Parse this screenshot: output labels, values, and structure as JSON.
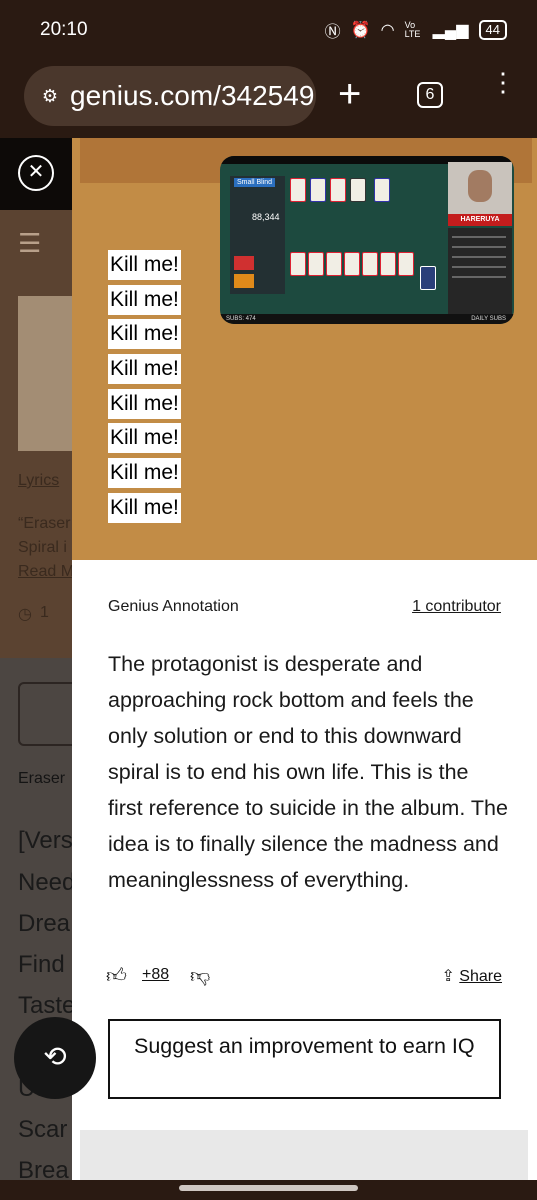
{
  "status_bar": {
    "time": "20:10",
    "battery": "44",
    "network": "Vo LTE"
  },
  "browser": {
    "url": "genius.com/342549",
    "tab_count": "6"
  },
  "background_page": {
    "lyrics_link": "Lyrics",
    "description_line1": "“Eraser",
    "description_line2": "Spiral i",
    "read_more": "Read M",
    "history_count": "1",
    "album_label": "Eraser",
    "lyric_fragments": [
      "[Vers",
      "Need",
      "Drea",
      "Find",
      "Taste",
      "Use",
      "Scar",
      "Brea"
    ]
  },
  "annotation": {
    "quoted_lines": [
      "Kill me!",
      "Kill me!",
      "Kill me!",
      "Kill me!",
      "Kill me!",
      "Kill me!",
      "Kill me!",
      "Kill me!"
    ],
    "label": "Genius Annotation",
    "contributors": "1 contributor",
    "body": "The protagonist is desperate and approaching rock bottom and feels the only solution or end to this downward spiral is to end his own life. This is the first reference to suicide in the album. The idea is to finally silence the madness and meaninglessness of everything.",
    "votes": "+88",
    "share_label": "Share",
    "suggest_label": "Suggest an improvement to earn IQ"
  },
  "video": {
    "blind_label": "Small Blind",
    "score": "88,344",
    "brand": "HARERUYA",
    "subs_left": "SUBS: 474",
    "subs_right": "DAILY SUBS"
  },
  "icons": {
    "close": "close-icon",
    "tune": "tune-icon",
    "thumb_up": "thumb-up-icon",
    "thumb_down": "thumb-down-icon",
    "share": "share-icon",
    "rotate": "screen-rotate-icon"
  }
}
